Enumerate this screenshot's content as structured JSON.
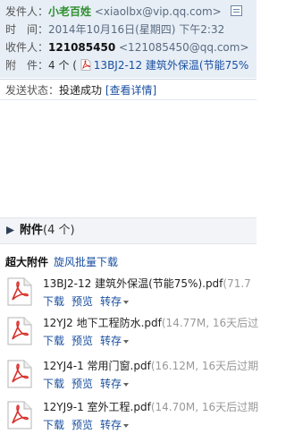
{
  "header": {
    "sender_label": "发件人：",
    "sender_name": "小老百姓",
    "sender_email": "<xiaolbx@vip.qq.com>",
    "time_label": "时　间：",
    "time_value": "2014年10月16日(星期四) 下午2:32",
    "recipient_label": "收件人：",
    "recipient_name": "121085450",
    "recipient_email": "<121085450@qq.com>",
    "attach_label": "附　件：",
    "attach_count": "4 个 (",
    "attach_first": "13BJ2-12 建筑外保温(节能75%"
  },
  "status": {
    "label": "发送状态：",
    "value": "投递成功",
    "detail_link": "[查看详情]"
  },
  "attachments_section": {
    "title": "附件",
    "count": "(4 个)",
    "big_label": "超大附件",
    "batch_download": "旋风批量下载"
  },
  "files": [
    {
      "name": "13BJ2-12 建筑外保温(节能75%).pdf",
      "meta": "(71.7"
    },
    {
      "name": "12YJ2 地下工程防水.pdf",
      "meta": "(14.77M, 16天后过"
    },
    {
      "name": "12YJ4-1 常用门窗.pdf",
      "meta": "(16.12M, 16天后过期"
    },
    {
      "name": "12YJ9-1 室外工程.pdf",
      "meta": "(14.70M, 16天后过期"
    }
  ],
  "actions": {
    "download": "下载",
    "preview": "预览",
    "save": "转存"
  },
  "colors": {
    "header_bg": "#e7eef6",
    "link": "#1a4fa0",
    "sender": "#2f8f2f",
    "pdf_red": "#d8302b"
  }
}
